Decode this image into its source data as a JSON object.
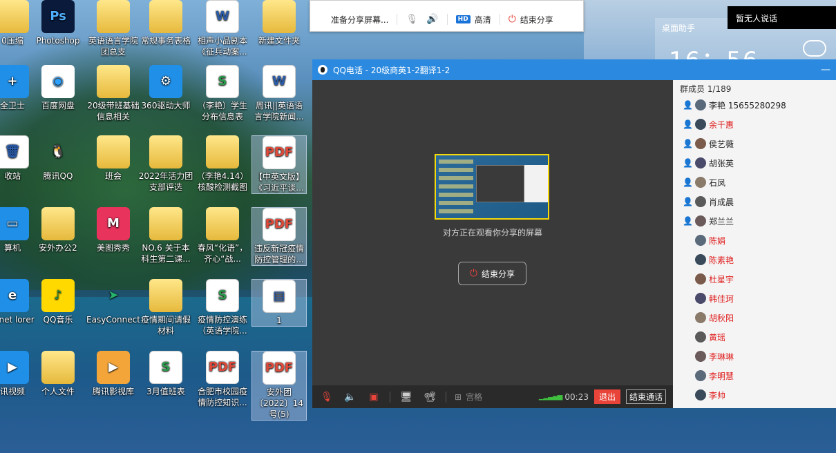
{
  "desktop": {
    "icons": [
      {
        "id": "c0r0",
        "label": "0压缩"
      },
      {
        "id": "c1r0",
        "label": "Photoshop"
      },
      {
        "id": "c2r0",
        "label": "英语语言学院团总支"
      },
      {
        "id": "c3r0",
        "label": "常规事务表格"
      },
      {
        "id": "c4r0",
        "label": "相声小品剧本《征兵动案..."
      },
      {
        "id": "c5r0",
        "label": "新建文件夹"
      },
      {
        "id": "c0r1",
        "label": "全卫士"
      },
      {
        "id": "c1r1",
        "label": "百度网盘"
      },
      {
        "id": "c2r1",
        "label": "20级带班基础信息相关"
      },
      {
        "id": "c3r1",
        "label": "360驱动大师"
      },
      {
        "id": "c4r1",
        "label": "（李艳）学生分布信息表"
      },
      {
        "id": "c5r1",
        "label": "周讯||英语语言学院新闻..."
      },
      {
        "id": "c0r2",
        "label": "收站"
      },
      {
        "id": "c1r2",
        "label": "腾讯QQ"
      },
      {
        "id": "c2r2",
        "label": "班会"
      },
      {
        "id": "c3r2",
        "label": "2022年活力团支部评选"
      },
      {
        "id": "c4r2",
        "label": "（李艳4.14）核酸检测截图"
      },
      {
        "id": "c5r2",
        "label": "【中英文版】《习近平谈..."
      },
      {
        "id": "c0r3",
        "label": "算机"
      },
      {
        "id": "c1r3",
        "label": "安外办公2"
      },
      {
        "id": "c2r3",
        "label": "美图秀秀"
      },
      {
        "id": "c3r3",
        "label": "NO.6 关于本科生第二课..."
      },
      {
        "id": "c4r3",
        "label": "春风“化语”，齐心“战..."
      },
      {
        "id": "c5r3",
        "label": "违反新冠疫情防控管理的..."
      },
      {
        "id": "c0r4",
        "label": "ernet lorer"
      },
      {
        "id": "c1r4",
        "label": "QQ音乐"
      },
      {
        "id": "c2r4",
        "label": "EasyConnect"
      },
      {
        "id": "c3r4",
        "label": "疫情期间请假材料"
      },
      {
        "id": "c4r4",
        "label": "疫情防控演练（英语学院..."
      },
      {
        "id": "c5r4",
        "label": "1"
      },
      {
        "id": "c0r5",
        "label": "讯视频"
      },
      {
        "id": "c1r5",
        "label": "个人文件"
      },
      {
        "id": "c2r5",
        "label": "腾讯影视库"
      },
      {
        "id": "c3r5",
        "label": "3月值班表"
      },
      {
        "id": "c4r5",
        "label": "合肥市校园疫情防控知识..."
      },
      {
        "id": "c5r5",
        "label": "安外团〔2022〕14号(5)"
      }
    ]
  },
  "share_bar": {
    "preparing": "准备分享屏幕...",
    "hd_badge": "HD",
    "hd_label": "高清",
    "end_share": "结束分享"
  },
  "desk_helper": {
    "title": "桌面助手",
    "clock": "16：56"
  },
  "tooltip": {
    "nobody_speaking": "暂无人说话"
  },
  "qq_call": {
    "title": "QQ电话 - 20级商英1-2翻译1-2",
    "minimize": "—",
    "watching_text": "对方正在观看你分享的屏幕",
    "end_share_btn": "结束分享",
    "toolbar": {
      "grid_label": "宫格",
      "timer": "00:23",
      "exit": "退出",
      "end_call": "结束通话"
    },
    "members": {
      "header": "群成员 1/189",
      "list": [
        {
          "name": "李艳 15655280298",
          "red": false,
          "leader": true
        },
        {
          "name": "余千惠",
          "red": true,
          "leader": true
        },
        {
          "name": "侯艺薇",
          "red": false,
          "leader": true
        },
        {
          "name": "胡张英",
          "red": false,
          "leader": true
        },
        {
          "name": "石凤",
          "red": false,
          "leader": true
        },
        {
          "name": "肖成晨",
          "red": false,
          "leader": true
        },
        {
          "name": "郑兰兰",
          "red": false,
          "leader": true
        },
        {
          "name": "陈娟",
          "red": true,
          "leader": false
        },
        {
          "name": "陈素艳",
          "red": true,
          "leader": false
        },
        {
          "name": "杜星宇",
          "red": true,
          "leader": false
        },
        {
          "name": "韩佳珂",
          "red": true,
          "leader": false
        },
        {
          "name": "胡秋阳",
          "red": true,
          "leader": false
        },
        {
          "name": "黄瑶",
          "red": true,
          "leader": false
        },
        {
          "name": "李琳琳",
          "red": true,
          "leader": false
        },
        {
          "name": "李明慧",
          "red": true,
          "leader": false
        },
        {
          "name": "李帅",
          "red": true,
          "leader": false
        }
      ]
    }
  }
}
